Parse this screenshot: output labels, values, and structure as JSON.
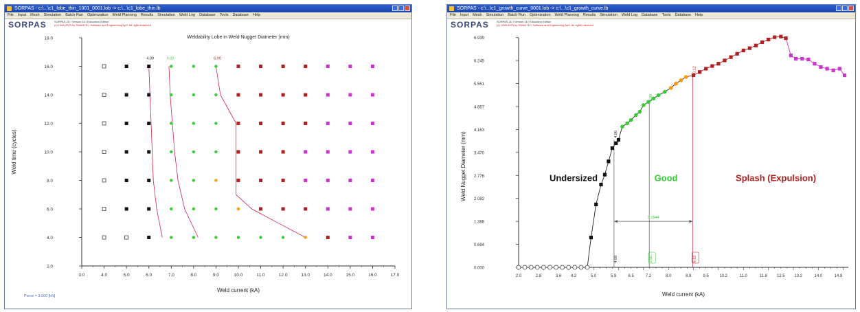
{
  "left_window": {
    "title": "SORPAS - c:\\...\\c1_lobe_thin_1001_0001.lob -> c:\\...\\c1_lobe_thin.lb",
    "menu": [
      "File",
      "Input",
      "Mesh",
      "Simulation",
      "Batch Run",
      "Optimization",
      "Weld Planning",
      "Results",
      "Simulation",
      "Weld Log",
      "Database",
      "Tools",
      "Database",
      "Help"
    ],
    "logo": "SORPAS",
    "header_line1": "SORPAS 2D / Version 16 / Education Edition",
    "header_line2": "(c) 1998-2023 by SWANTEC Software and Engineering ApS. All rights reserved."
  },
  "right_window": {
    "title": "SORPAS - c:\\...\\c1_growth_curve_0001.lob -> c:\\...\\c1_growth_curve.lb",
    "menu": [
      "File",
      "Input",
      "Mesh",
      "Simulation",
      "Batch Run",
      "Optimization",
      "Weld Planning",
      "Results",
      "Simulation",
      "Weld Log",
      "Database",
      "Tools",
      "Database",
      "Help"
    ],
    "logo": "SORPAS",
    "header_line1": "SORPAS 2D / Version 16 / Education Edition",
    "header_line2": "(c) 1998-2023 by SWANTEC Software and Engineering ApS. All rights reserved."
  },
  "colors": {
    "undersized": "#111111",
    "good": "#33cc33",
    "borderline": "#ff9900",
    "splash": "#b02020",
    "severe_splash": "#cc33cc",
    "no_weld": "#ffffff",
    "boundary_line": "#cc2244",
    "axis": "#333333"
  },
  "chart_data": [
    {
      "type": "scatter",
      "title": "Weldability Lobe in Weld Nugget Diameter (mm)",
      "xlabel": "Weld current (kA)",
      "ylabel": "Weld time (cycles)",
      "xlim": [
        3.0,
        17.0
      ],
      "ylim": [
        2.0,
        18.0
      ],
      "x_ticks": [
        "3.0",
        "4.0",
        "5.0",
        "6.0",
        "7.0",
        "8.0",
        "9.0",
        "10.0",
        "11.0",
        "12.0",
        "13.0",
        "14.0",
        "15.0",
        "16.0",
        "17.0"
      ],
      "y_ticks": [
        "2.0",
        "4.0",
        "6.0",
        "8.0",
        "10.0",
        "12.0",
        "14.0",
        "16.0",
        "18.0"
      ],
      "currents": [
        4.0,
        5.0,
        6.0,
        7.0,
        8.0,
        9.0,
        10.0,
        11.0,
        12.0,
        13.0,
        14.0,
        15.0,
        16.0
      ],
      "times": [
        4.0,
        6.0,
        8.0,
        10.0,
        12.0,
        14.0,
        16.0
      ],
      "status_grid": [
        [
          "none",
          "none",
          "under",
          "good",
          "good",
          "good",
          "good",
          "good",
          "good",
          "border",
          "splash",
          "severe",
          "severe"
        ],
        [
          "none",
          "under",
          "under",
          "good",
          "good",
          "good",
          "border",
          "splash",
          "splash",
          "splash",
          "severe",
          "severe",
          "severe"
        ],
        [
          "none",
          "under",
          "under",
          "good",
          "good",
          "border",
          "splash",
          "splash",
          "splash",
          "severe",
          "severe",
          "severe",
          "severe"
        ],
        [
          "none",
          "under",
          "under",
          "good",
          "good",
          "good",
          "splash",
          "splash",
          "splash",
          "severe",
          "severe",
          "severe",
          "severe"
        ],
        [
          "none",
          "under",
          "under",
          "good",
          "good",
          "good",
          "splash",
          "splash",
          "splash",
          "splash",
          "severe",
          "severe",
          "severe"
        ],
        [
          "none",
          "under",
          "under",
          "good",
          "good",
          "good",
          "splash",
          "splash",
          "splash",
          "splash",
          "severe",
          "severe",
          "severe"
        ],
        [
          "none",
          "under",
          "under",
          "good",
          "good",
          "good",
          "splash",
          "splash",
          "splash",
          "splash",
          "severe",
          "severe",
          "severe"
        ]
      ],
      "boundaries": [
        {
          "label": "4.00",
          "points": [
            [
              6.6,
              4.0
            ],
            [
              6.35,
              6.0
            ],
            [
              6.2,
              8.0
            ],
            [
              6.15,
              10.0
            ],
            [
              6.1,
              12.0
            ],
            [
              6.05,
              14.0
            ],
            [
              6.0,
              16.0
            ]
          ]
        },
        {
          "label": "5.00",
          "points": [
            [
              8.2,
              4.0
            ],
            [
              7.6,
              6.0
            ],
            [
              7.3,
              8.0
            ],
            [
              7.15,
              10.0
            ],
            [
              7.05,
              12.0
            ],
            [
              6.95,
              14.0
            ],
            [
              6.9,
              16.0
            ]
          ]
        },
        {
          "label": "6.00",
          "points": [
            [
              13.0,
              4.0
            ],
            [
              11.8,
              5.0
            ],
            [
              10.6,
              6.0
            ],
            [
              9.9,
              7.0
            ],
            [
              9.9,
              8.0
            ],
            [
              9.9,
              10.0
            ],
            [
              9.9,
              12.0
            ],
            [
              9.2,
              14.0
            ],
            [
              9.0,
              16.0
            ]
          ]
        }
      ],
      "footnote": "Force = 3.000 [kN]"
    },
    {
      "type": "line",
      "xlabel": "Weld current (kA)",
      "ylabel": "Weld Nugget Diameter (mm)",
      "xlim": [
        2.0,
        15.2
      ],
      "ylim": [
        0.0,
        6.933
      ],
      "x_ticks": [
        "2.0",
        "2.8",
        "3.6",
        "4.2",
        "5.0",
        "5.8",
        "6.5",
        "7.2",
        "8.0",
        "8.8",
        "9.5",
        "10.2",
        "11.0",
        "11.8",
        "12.5",
        "13.2",
        "14.0",
        "14.8"
      ],
      "y_ticks": [
        "0.000",
        "0.694",
        "1.388",
        "2.082",
        "2.776",
        "3.470",
        "4.163",
        "4.857",
        "5.551",
        "6.245",
        "6.939"
      ],
      "regions": [
        "Undersized",
        "Good",
        "Splash (Expulsion)"
      ],
      "markers": [
        {
          "label": "4.00",
          "x": 5.82
        },
        {
          "label": "5.00",
          "x": 7.23
        },
        {
          "label": "6.12",
          "x": 8.97
        }
      ],
      "range_label": "3.1544",
      "threshold_labels": [
        "4.00",
        "5.00",
        "6.12"
      ],
      "curve": [
        {
          "x": 2.0,
          "y": 0.0
        },
        {
          "x": 2.25,
          "y": 0.0
        },
        {
          "x": 2.5,
          "y": 0.0
        },
        {
          "x": 2.75,
          "y": 0.0
        },
        {
          "x": 3.0,
          "y": 0.0
        },
        {
          "x": 3.25,
          "y": 0.0
        },
        {
          "x": 3.5,
          "y": 0.0
        },
        {
          "x": 3.75,
          "y": 0.0
        },
        {
          "x": 4.0,
          "y": 0.0
        },
        {
          "x": 4.25,
          "y": 0.0
        },
        {
          "x": 4.5,
          "y": 0.0
        },
        {
          "x": 4.75,
          "y": 0.0
        },
        {
          "x": 4.9,
          "y": 0.9
        },
        {
          "x": 5.1,
          "y": 1.9
        },
        {
          "x": 5.3,
          "y": 2.5
        },
        {
          "x": 5.45,
          "y": 2.8
        },
        {
          "x": 5.6,
          "y": 3.2
        },
        {
          "x": 5.75,
          "y": 3.6
        },
        {
          "x": 5.9,
          "y": 3.75
        },
        {
          "x": 6.0,
          "y": 3.85
        },
        {
          "x": 6.15,
          "y": 4.25
        },
        {
          "x": 6.35,
          "y": 4.35
        },
        {
          "x": 6.5,
          "y": 4.45
        },
        {
          "x": 6.7,
          "y": 4.6
        },
        {
          "x": 6.85,
          "y": 4.7
        },
        {
          "x": 7.0,
          "y": 4.9
        },
        {
          "x": 7.2,
          "y": 5.0
        },
        {
          "x": 7.4,
          "y": 5.1
        },
        {
          "x": 7.6,
          "y": 5.2
        },
        {
          "x": 7.85,
          "y": 5.3
        },
        {
          "x": 8.1,
          "y": 5.42
        },
        {
          "x": 8.3,
          "y": 5.55
        },
        {
          "x": 8.5,
          "y": 5.65
        },
        {
          "x": 8.7,
          "y": 5.75
        },
        {
          "x": 9.0,
          "y": 5.8
        },
        {
          "x": 9.25,
          "y": 5.9
        },
        {
          "x": 9.5,
          "y": 6.0
        },
        {
          "x": 9.75,
          "y": 6.08
        },
        {
          "x": 10.0,
          "y": 6.15
        },
        {
          "x": 10.25,
          "y": 6.25
        },
        {
          "x": 10.5,
          "y": 6.35
        },
        {
          "x": 10.75,
          "y": 6.45
        },
        {
          "x": 11.0,
          "y": 6.55
        },
        {
          "x": 11.25,
          "y": 6.62
        },
        {
          "x": 11.5,
          "y": 6.7
        },
        {
          "x": 11.75,
          "y": 6.8
        },
        {
          "x": 12.0,
          "y": 6.88
        },
        {
          "x": 12.25,
          "y": 6.95
        },
        {
          "x": 12.5,
          "y": 6.97
        },
        {
          "x": 12.7,
          "y": 6.92
        },
        {
          "x": 12.9,
          "y": 6.4
        },
        {
          "x": 13.1,
          "y": 6.3
        },
        {
          "x": 13.35,
          "y": 6.3
        },
        {
          "x": 13.6,
          "y": 6.28
        },
        {
          "x": 13.85,
          "y": 6.15
        },
        {
          "x": 14.1,
          "y": 6.05
        },
        {
          "x": 14.35,
          "y": 6.0
        },
        {
          "x": 14.6,
          "y": 5.95
        },
        {
          "x": 14.85,
          "y": 6.0
        },
        {
          "x": 15.05,
          "y": 5.8
        }
      ],
      "status": [
        "none",
        "none",
        "none",
        "none",
        "none",
        "none",
        "none",
        "none",
        "none",
        "none",
        "none",
        "none",
        "under",
        "under",
        "under",
        "under",
        "under",
        "under",
        "under",
        "under",
        "good",
        "good",
        "good",
        "good",
        "good",
        "good",
        "good",
        "good",
        "good",
        "good",
        "border",
        "border",
        "border",
        "border",
        "splash",
        "splash",
        "splash",
        "splash",
        "splash",
        "splash",
        "splash",
        "splash",
        "splash",
        "splash",
        "splash",
        "splash",
        "splash",
        "splash",
        "splash",
        "splash",
        "severe",
        "severe",
        "severe",
        "severe",
        "severe",
        "severe",
        "severe",
        "severe",
        "severe",
        "severe"
      ]
    }
  ]
}
